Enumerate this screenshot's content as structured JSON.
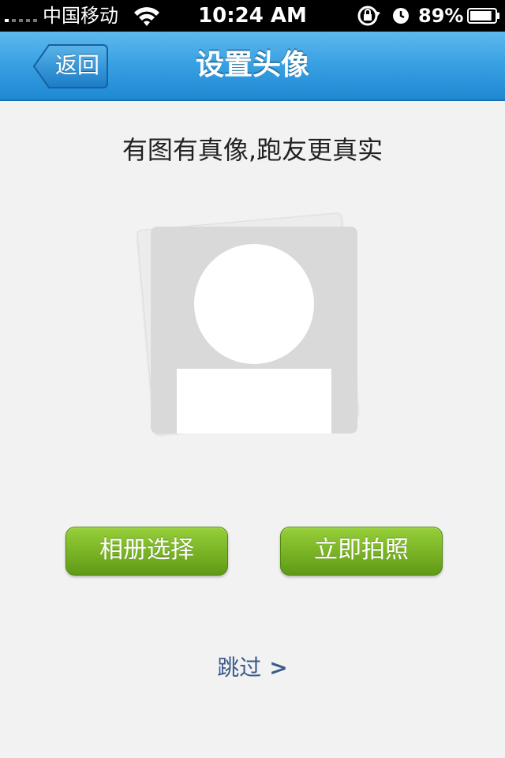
{
  "status_bar": {
    "carrier": "中国移动",
    "time": "10:24 AM",
    "battery_percent": "89%",
    "battery_level": 0.89,
    "icons": [
      "signal-icon",
      "wifi-icon",
      "rotation-lock-icon",
      "alarm-icon",
      "battery-icon"
    ]
  },
  "nav": {
    "back_label": "返回",
    "title": "设置头像"
  },
  "content": {
    "subtitle": "有图有真像,跑友更真实",
    "avatar_icon": "avatar-placeholder-icon",
    "album_button": "相册选择",
    "camera_button": "立即拍照",
    "skip_label": "跳过",
    "skip_arrow": ">"
  },
  "colors": {
    "nav_blue": "#3aa2e3",
    "button_green": "#7bb526",
    "skip_link": "#3c5a8a",
    "background": "#f2f2f2"
  }
}
